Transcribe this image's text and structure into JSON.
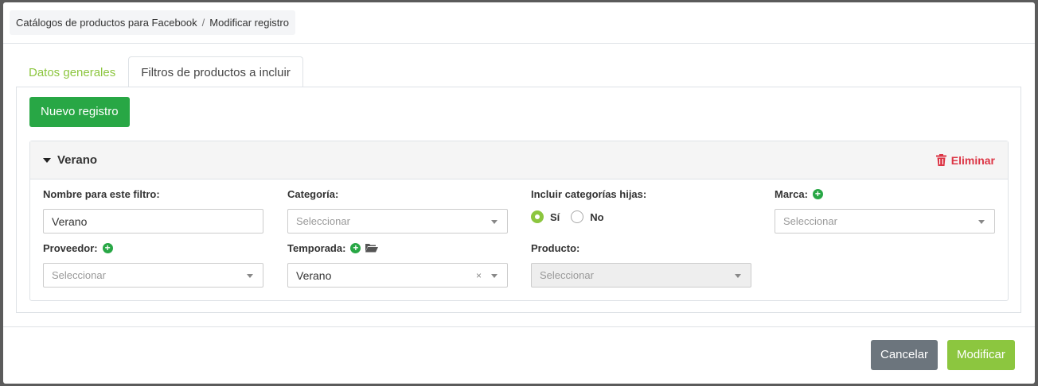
{
  "breadcrumb": {
    "items": [
      "Catálogos de productos para Facebook",
      "Modificar registro"
    ],
    "separator": "/"
  },
  "tabs": [
    {
      "label": "Datos generales",
      "active": false
    },
    {
      "label": "Filtros de productos a incluir",
      "active": true
    }
  ],
  "new_button": "Nuevo registro",
  "filter": {
    "title": "Verano",
    "delete_label": "Eliminar",
    "nombre": {
      "label": "Nombre para este filtro:",
      "value": "Verano"
    },
    "categoria": {
      "label": "Categoría:",
      "placeholder": "Seleccionar"
    },
    "incluir": {
      "label": "Incluir categorías hijas:",
      "options": [
        "Sí",
        "No"
      ],
      "selected": "Sí"
    },
    "marca": {
      "label": "Marca:",
      "placeholder": "Seleccionar"
    },
    "proveedor": {
      "label": "Proveedor:",
      "placeholder": "Seleccionar"
    },
    "temporada": {
      "label": "Temporada:",
      "value": "Verano",
      "clear": "×"
    },
    "producto": {
      "label": "Producto:",
      "placeholder": "Seleccionar",
      "disabled": true
    }
  },
  "footer": {
    "cancel": "Cancelar",
    "submit": "Modificar"
  },
  "colors": {
    "accent": "#8cc63f",
    "success": "#28a745",
    "danger": "#dc3545",
    "secondary": "#6c757d"
  }
}
